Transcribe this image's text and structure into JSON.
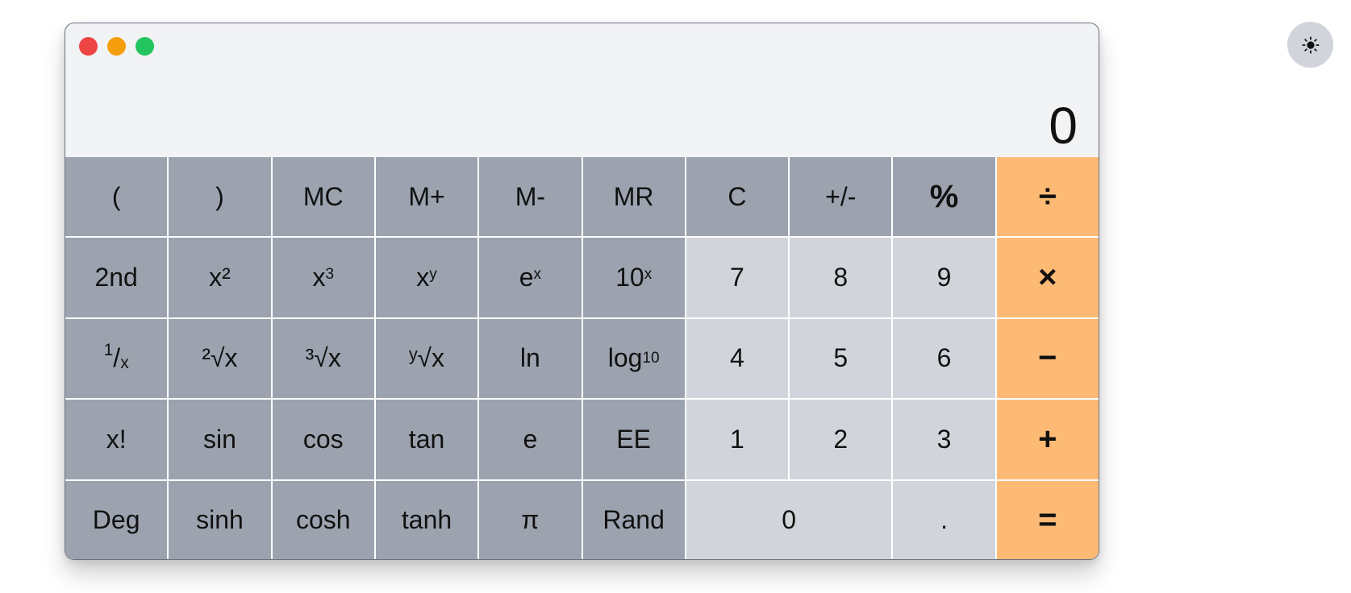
{
  "window": {
    "traffic_lights": [
      "close",
      "minimize",
      "zoom"
    ],
    "colors": {
      "close": "#ef4444",
      "minimize": "#f59e0b",
      "zoom": "#22c55e"
    }
  },
  "display": {
    "value": "0"
  },
  "keys": {
    "open_paren": "(",
    "close_paren": ")",
    "mc": "MC",
    "m_plus": "M+",
    "m_minus": "M-",
    "mr": "MR",
    "clear": "C",
    "plus_minus": "+/-",
    "percent": "%",
    "divide": "÷",
    "second": "2nd",
    "x_squared": "x²",
    "x_cubed_base": "x",
    "x_cubed_exp": "3",
    "x_pow_y_base": "x",
    "x_pow_y_exp": "y",
    "e_pow_x_base": "e",
    "e_pow_x_exp": "x",
    "ten_pow_x_base": "10",
    "ten_pow_x_exp": "x",
    "seven": "7",
    "eight": "8",
    "nine": "9",
    "multiply": "×",
    "reciprocal_num": "1",
    "reciprocal_slash": "/",
    "reciprocal_den": "x",
    "sqrt": "²√x",
    "cbrt": "³√x",
    "yroot": "ʸ√x",
    "ln": "ln",
    "log10_base": "log",
    "log10_sub": "10",
    "four": "4",
    "five": "5",
    "six": "6",
    "subtract": "−",
    "factorial": "x!",
    "sin": "sin",
    "cos": "cos",
    "tan": "tan",
    "e": "e",
    "ee": "EE",
    "one": "1",
    "two": "2",
    "three": "3",
    "add": "+",
    "deg": "Deg",
    "sinh": "sinh",
    "cosh": "cosh",
    "tanh": "tanh",
    "pi": "π",
    "rand": "Rand",
    "zero": "0",
    "decimal": ".",
    "equals": "="
  },
  "theme_toggle": {
    "icon": "sun-icon"
  },
  "colors": {
    "window_bg": "#f2f3f5",
    "function_key": "#9ca3af",
    "number_key": "#d1d5db",
    "operator_key": "#fdba74",
    "toggle_bg": "#d1d5db"
  }
}
